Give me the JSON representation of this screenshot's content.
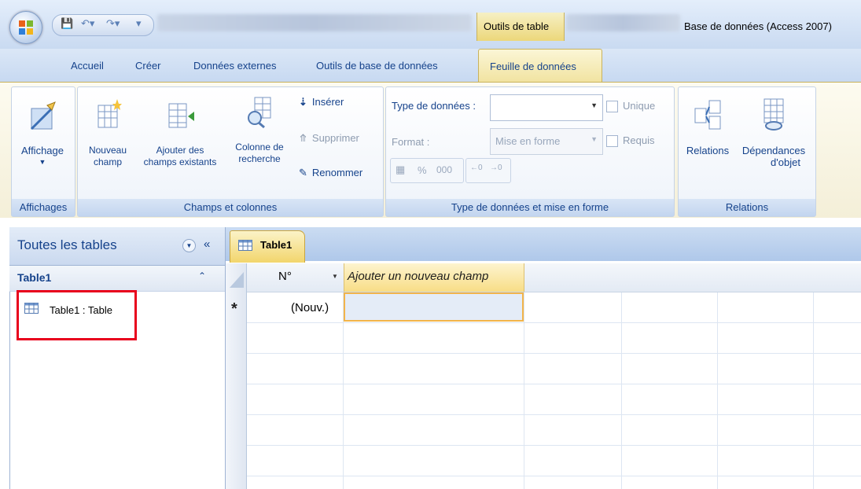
{
  "title_bar": {
    "context_tab": "Outils de table",
    "app_title": "Base de données (Access 2007)"
  },
  "tabs": [
    "Accueil",
    "Créer",
    "Données externes",
    "Outils de base de données",
    "Feuille de données"
  ],
  "ribbon": {
    "group_affichages": {
      "view_button_label": "Affichage",
      "group_label": "Affichages"
    },
    "group_champs": {
      "new_field_line1": "Nouveau",
      "new_field_line2": "champ",
      "add_existing_line1": "Ajouter des",
      "add_existing_line2": "champs existants",
      "lookup_line1": "Colonne de",
      "lookup_line2": "recherche",
      "insert": "Insérer",
      "delete": "Supprimer",
      "rename": "Renommer",
      "group_label": "Champs et colonnes"
    },
    "group_types": {
      "data_type_label": "Type de données :",
      "format_label": "Format :",
      "format_value": "Mise en forme",
      "unique": "Unique",
      "required": "Requis",
      "percent": "%",
      "thousands": "000",
      "group_label": "Type de données et mise en forme"
    },
    "group_relations": {
      "relations": "Relations",
      "dependencies_line1": "Dépendances",
      "dependencies_line2": "d'objet",
      "group_label": "Relations"
    }
  },
  "nav_pane": {
    "header": "Toutes les tables",
    "group_title": "Table1",
    "item_label": "Table1 : Table"
  },
  "datasheet": {
    "tab_label": "Table1",
    "column_id": "N°",
    "column_add": "Ajouter un nouveau champ",
    "new_row_marker": "*",
    "new_row_value": "(Nouv.)"
  },
  "colors": {
    "highlight_red": "#e8001c",
    "accent_yellow": "#f2d56c",
    "ribbon_blue": "#15428b"
  }
}
